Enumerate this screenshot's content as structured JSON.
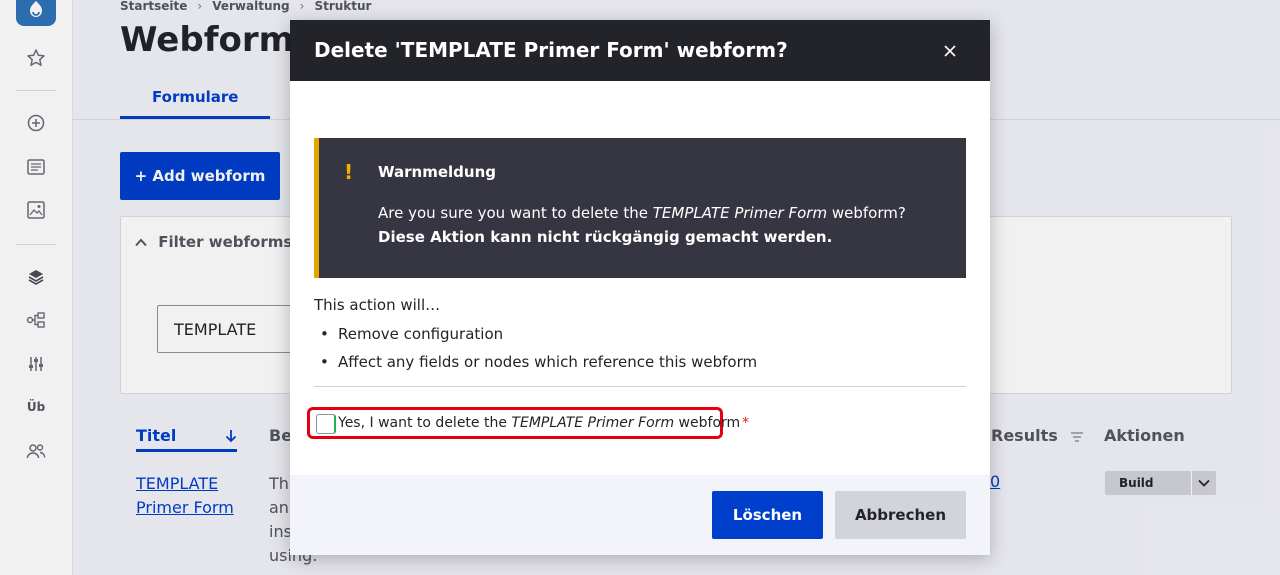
{
  "toolbar": {
    "icons": [
      "drupal-logo",
      "star-icon",
      "plus-circle-icon",
      "content-icon",
      "media-icon",
      "structure-icon",
      "workflow-icon",
      "config-icon",
      "translate-icon",
      "people-icon"
    ],
    "translate_label": "Üb"
  },
  "breadcrumb": [
    "Startseite",
    "Verwaltung",
    "Struktur"
  ],
  "page_title": "Webformulare",
  "tabs": {
    "active": "Formulare"
  },
  "add_button": "+ Add webform",
  "filter": {
    "title": "Filter webforms",
    "search_value": "TEMPLATE"
  },
  "table": {
    "headers": {
      "title": "Titel",
      "description": "Be",
      "results": "Results",
      "actions": "Aktionen"
    },
    "row": {
      "title": "TEMPLATE Primer Form",
      "description_lines": [
        "Thi",
        "anc",
        "ins",
        "using."
      ],
      "results": "0",
      "build": "Build"
    }
  },
  "modal": {
    "title": "Delete 'TEMPLATE Primer Form' webform?",
    "warning": {
      "icon": "!",
      "title": "Warnmeldung",
      "line1_prefix": "Are you sure you want to delete the ",
      "line1_em": "TEMPLATE Primer Form",
      "line1_suffix": " webform?",
      "line2": "Diese Aktion kann nicht rückgängig gemacht werden."
    },
    "action_intro": "This action will…",
    "actions": [
      "Remove configuration",
      "Affect any fields or nodes which reference this webform"
    ],
    "confirm": {
      "prefix": "Yes, I want to delete the ",
      "em": "TEMPLATE Primer Form",
      "suffix": " webform",
      "required_mark": "*"
    },
    "buttons": {
      "delete": "Löschen",
      "cancel": "Abbrechen"
    }
  },
  "colors": {
    "primary": "#003ecc",
    "header_dark": "#232429",
    "warning_accent": "#e4a400",
    "highlight_red": "#e4000f"
  }
}
